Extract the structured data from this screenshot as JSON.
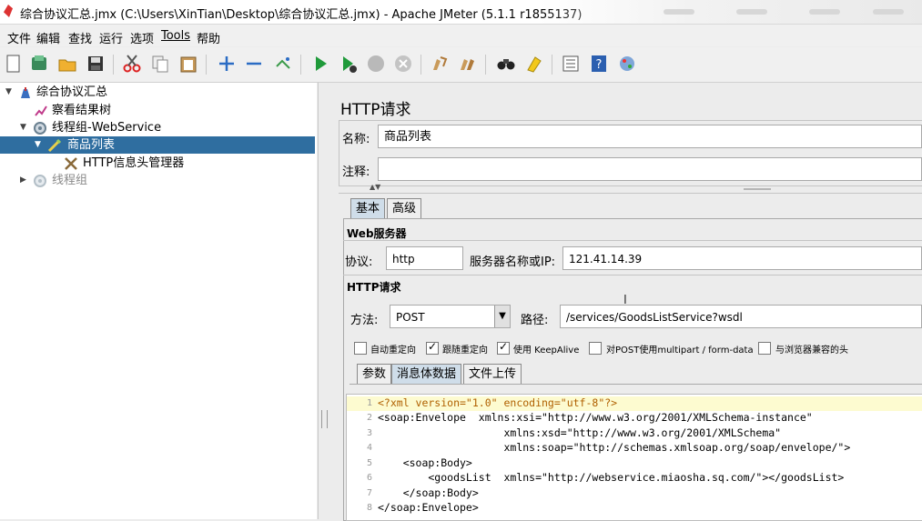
{
  "window": {
    "title": "综合协议汇总.jmx (C:\\Users\\XinTian\\Desktop\\综合协议汇总.jmx) - Apache JMeter (5.1.1 r1855137)"
  },
  "menu": [
    "文件",
    "编辑",
    "查找",
    "运行",
    "选项",
    "Tools",
    "帮助"
  ],
  "toolbar": {
    "icons": [
      "new-icon",
      "templates-icon",
      "open-icon",
      "save-icon",
      "cut-icon",
      "copy-icon",
      "paste-icon",
      "expand-icon",
      "collapse-icon",
      "toggle-icon",
      "start-icon",
      "start-no-pause-icon",
      "stop-icon",
      "shutdown-icon",
      "clear-icon",
      "clear-all-icon",
      "search-icon",
      "reset-search-icon",
      "function-helper-icon",
      "help-icon",
      "remote-icon"
    ]
  },
  "tree": {
    "items": [
      {
        "label": "综合协议汇总",
        "icon": "testplan-icon"
      },
      {
        "label": "察看结果树",
        "icon": "listener-icon"
      },
      {
        "label": "线程组-WebService",
        "icon": "threadgroup-icon"
      },
      {
        "label": "商品列表",
        "icon": "sampler-icon"
      },
      {
        "label": "HTTP信息头管理器",
        "icon": "config-icon"
      },
      {
        "label": "线程组",
        "icon": "threadgroup-icon"
      }
    ]
  },
  "panel": {
    "title": "HTTP请求",
    "name_label": "名称:",
    "name_value": "商品列表",
    "comment_label": "注释:",
    "comment_value": "",
    "tabs": [
      "基本",
      "高级"
    ],
    "web_server": {
      "section": "Web服务器",
      "protocol_label": "协议:",
      "protocol_value": "http",
      "server_label": "服务器名称或IP:",
      "server_value": "121.41.14.39"
    },
    "http_request": {
      "section": "HTTP请求",
      "method_label": "方法:",
      "method_value": "POST",
      "path_label": "路径:",
      "path_value": "/services/GoodsListService?wsdl"
    },
    "options": [
      {
        "label": "自动重定向",
        "checked": false
      },
      {
        "label": "跟随重定向",
        "checked": true
      },
      {
        "label": "使用 KeepAlive",
        "checked": true
      },
      {
        "label": "对POST使用multipart / form-data",
        "checked": false
      },
      {
        "label": "与浏览器兼容的头",
        "checked": false
      }
    ],
    "body_tabs": [
      "参数",
      "消息体数据",
      "文件上传"
    ],
    "body_lines": [
      "<?xml version=\"1.0\" encoding=\"utf-8\"?>",
      "<soap:Envelope  xmlns:xsi=\"http://www.w3.org/2001/XMLSchema-instance\"",
      "                    xmlns:xsd=\"http://www.w3.org/2001/XMLSchema\"",
      "                    xmlns:soap=\"http://schemas.xmlsoap.org/soap/envelope/\">",
      "    <soap:Body>",
      "        <goodsList  xmlns=\"http://webservice.miaosha.sq.com/\"></goodsList>",
      "    </soap:Body>",
      "</soap:Envelope>"
    ]
  }
}
